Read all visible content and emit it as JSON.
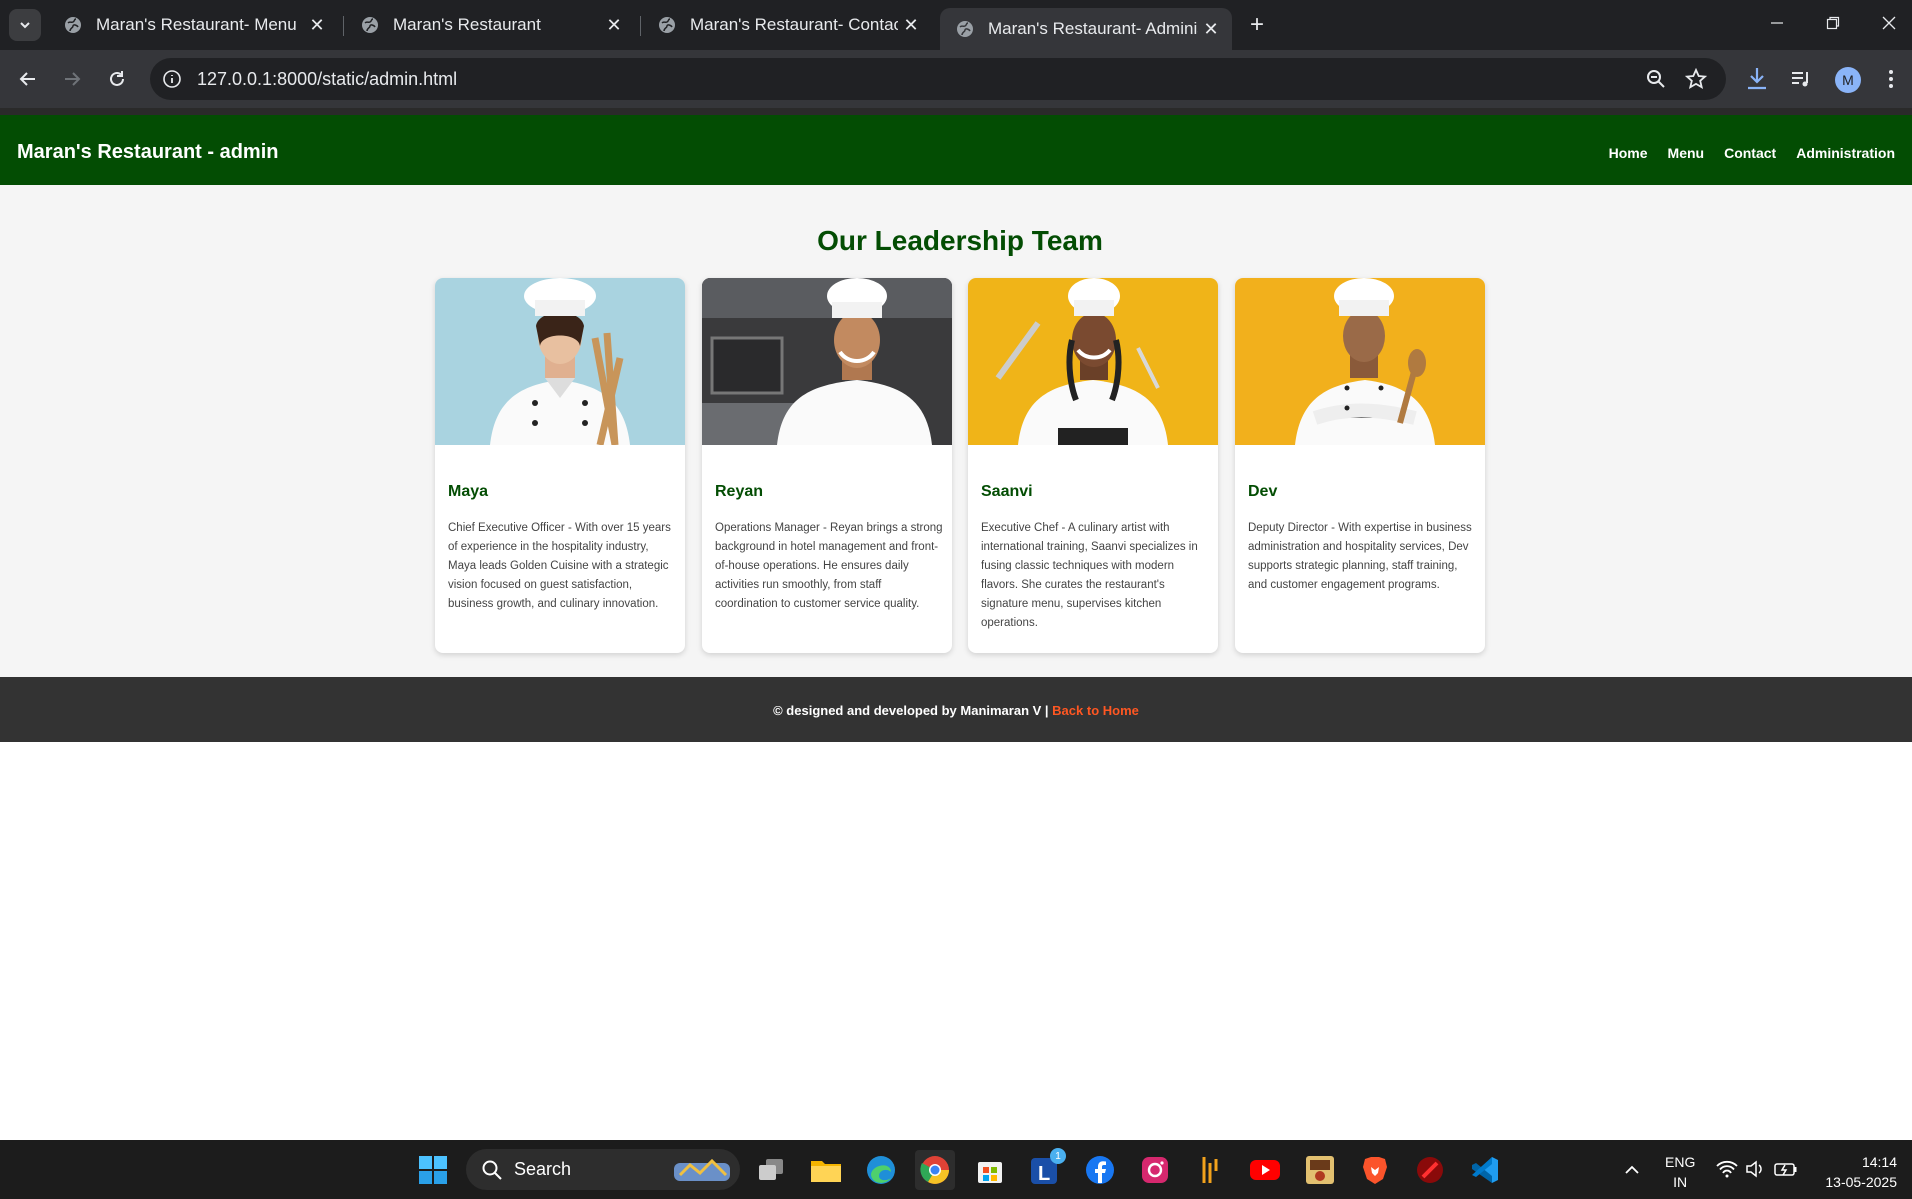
{
  "browser": {
    "tabs": [
      {
        "label": "Maran's Restaurant- Menu",
        "active": false
      },
      {
        "label": "Maran's Restaurant",
        "active": false
      },
      {
        "label": "Maran's Restaurant- Contact Us",
        "active": false
      },
      {
        "label": "Maran's Restaurant- Administra",
        "active": true
      }
    ],
    "url": "127.0.0.1:8000/static/admin.html",
    "profile_initial": "M"
  },
  "site": {
    "brand": "Maran's Restaurant - admin",
    "nav": [
      "Home",
      "Menu",
      "Contact",
      "Administration"
    ],
    "heading": "Our Leadership Team",
    "team": [
      {
        "name": "Maya",
        "bg": "#a9d3e0",
        "desc": "Chief Executive Officer - With over 15 years of experience in the hospitality industry, Maya leads Golden Cuisine with a strategic vision focused on guest satisfaction, business growth, and culinary innovation."
      },
      {
        "name": "Reyan",
        "bg": "#3a3a3c",
        "desc": "Operations Manager - Reyan brings a strong background in hotel management and front-of-house operations. He ensures daily activities run smoothly, from staff coordination to customer service quality."
      },
      {
        "name": "Saanvi",
        "bg": "#f0b418",
        "desc": "Executive Chef - A culinary artist with international training, Saanvi specializes in fusing classic techniques with modern flavors. She curates the restaurant's signature menu, supervises kitchen operations."
      },
      {
        "name": "Dev",
        "bg": "#f2b01c",
        "desc": "Deputy Director - With expertise in business administration and hospitality services, Dev supports strategic planning, staff training, and customer engagement programs."
      }
    ],
    "footer_text": "© designed and developed by Manimaran V | ",
    "footer_link": "Back to Home"
  },
  "taskbar": {
    "search_label": "Search",
    "lang_line1": "ENG",
    "lang_line2": "IN",
    "time": "14:14",
    "date": "13-05-2025",
    "badge_count": "1"
  },
  "colors": {
    "header": "#034d03",
    "accent": "#ff5722",
    "footer": "#333333"
  }
}
